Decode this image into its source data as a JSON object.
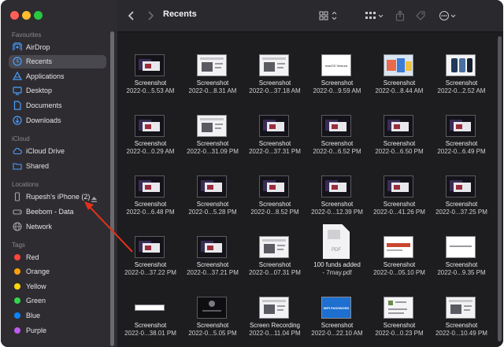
{
  "colors": {
    "accent_red": "#e3301b",
    "tag_red": "#ff453a",
    "tag_orange": "#ff9f0a",
    "tag_yellow": "#ffd60a",
    "tag_green": "#32d74b",
    "tag_blue": "#0a84ff",
    "tag_purple": "#bf5af2"
  },
  "toolbar": {
    "title": "Recents",
    "icons": [
      "back-chevron-icon",
      "forward-chevron-icon",
      "grid-view-icon",
      "group-by-icon",
      "share-icon",
      "tag-icon",
      "more-icon"
    ]
  },
  "sidebar": {
    "favourites_heading": "Favourites",
    "favourites": [
      {
        "label": "AirDrop",
        "icon": "airdrop-icon"
      },
      {
        "label": "Recents",
        "icon": "clock-icon",
        "selected": true
      },
      {
        "label": "Applications",
        "icon": "applications-icon"
      },
      {
        "label": "Desktop",
        "icon": "desktop-icon"
      },
      {
        "label": "Documents",
        "icon": "document-icon"
      },
      {
        "label": "Downloads",
        "icon": "download-icon"
      }
    ],
    "icloud_heading": "iCloud",
    "icloud": [
      {
        "label": "iCloud Drive",
        "icon": "cloud-icon"
      },
      {
        "label": "Shared",
        "icon": "shared-folder-icon"
      }
    ],
    "locations_heading": "Locations",
    "locations": [
      {
        "label": "Rupesh’s iPhone (2)",
        "icon": "iphone-icon"
      },
      {
        "label": "Beebom  - Data",
        "icon": "drive-icon"
      },
      {
        "label": "Network",
        "icon": "network-icon"
      }
    ],
    "tags_heading": "Tags",
    "tags": [
      {
        "label": "Red"
      },
      {
        "label": "Orange"
      },
      {
        "label": "Yellow"
      },
      {
        "label": "Green"
      },
      {
        "label": "Blue"
      },
      {
        "label": "Purple"
      }
    ]
  },
  "files": [
    [
      {
        "name": "Screenshot",
        "sub": "2022-0...5.53 AM",
        "thumb": "dark"
      },
      {
        "name": "Screenshot",
        "sub": "2022-0...8.31 AM",
        "thumb": "light"
      },
      {
        "name": "Screenshot",
        "sub": "2022-0...37.18 AM",
        "thumb": "light"
      },
      {
        "name": "Screenshot",
        "sub": "2022-0...9.59 AM",
        "thumb": "macos",
        "text": "macOS Ventura"
      },
      {
        "name": "Screenshot",
        "sub": "2022-0...8.44 AM",
        "thumb": "colorful"
      },
      {
        "name": "Screenshot",
        "sub": "2022-0...2.52 AM",
        "thumb": "phones"
      }
    ],
    [
      {
        "name": "Screenshot",
        "sub": "2022-0...0.29 AM",
        "thumb": "dark"
      },
      {
        "name": "Screenshot",
        "sub": "2022-0...31.09 PM",
        "thumb": "light"
      },
      {
        "name": "Screenshot",
        "sub": "2022-0...37.31 PM",
        "thumb": "dark"
      },
      {
        "name": "Screenshot",
        "sub": "2022-0...6.52 PM",
        "thumb": "dark"
      },
      {
        "name": "Screenshot",
        "sub": "2022-0...6.50 PM",
        "thumb": "dark"
      },
      {
        "name": "Screenshot",
        "sub": "2022-0...6.49 PM",
        "thumb": "dark"
      }
    ],
    [
      {
        "name": "Screenshot",
        "sub": "2022-0...6.48 PM",
        "thumb": "dark"
      },
      {
        "name": "Screenshot",
        "sub": "2022-0...5.28 PM",
        "thumb": "dark"
      },
      {
        "name": "Screenshot",
        "sub": "2022-0...8.52 PM",
        "thumb": "dark"
      },
      {
        "name": "Screenshot",
        "sub": "2022-0...12.39 PM",
        "thumb": "dark"
      },
      {
        "name": "Screenshot",
        "sub": "2022-0...41.26 PM",
        "thumb": "dark"
      },
      {
        "name": "Screenshot",
        "sub": "2022-0...37.25 PM",
        "thumb": "dark"
      }
    ],
    [
      {
        "name": "Screenshot",
        "sub": "2022-0...37.22 PM",
        "thumb": "dark"
      },
      {
        "name": "Screenshot",
        "sub": "2022-0...37.21 PM",
        "thumb": "dark"
      },
      {
        "name": "Screenshot",
        "sub": "2022-0...07.31 PM",
        "thumb": "light"
      },
      {
        "name": "100 funds added",
        "sub": "- 7may.pdf",
        "thumb": "pdf",
        "text": "PDF"
      },
      {
        "name": "Screenshot",
        "sub": "2022-0...05.10 PM",
        "thumb": "webred"
      },
      {
        "name": "Screenshot",
        "sub": "2022-0...9.35 PM",
        "thumb": "white"
      }
    ],
    [
      {
        "name": "Screenshot",
        "sub": "2022-0...38.01 PM",
        "thumb": "strip"
      },
      {
        "name": "Screenshot",
        "sub": "2022-0...5.05 PM",
        "thumb": "black"
      },
      {
        "name": "Screen Recording",
        "sub": "2022-0...11.04 PM",
        "thumb": "light"
      },
      {
        "name": "Screenshot",
        "sub": "2022-0...22.10 AM",
        "thumb": "wifi",
        "text": "WIFI PASSWORD"
      },
      {
        "name": "Screenshot",
        "sub": "2022-0...0.23 PM",
        "thumb": "doc"
      },
      {
        "name": "Screenshot",
        "sub": "2022-0...10.49 PM",
        "thumb": "light"
      }
    ]
  ]
}
